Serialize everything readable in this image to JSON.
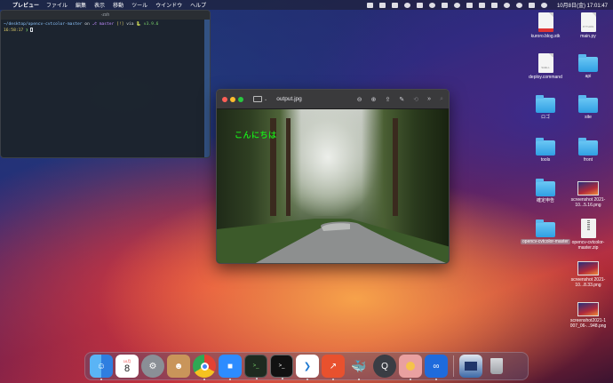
{
  "menubar": {
    "apple_icon": "apple-icon",
    "app_name": "プレビュー",
    "items": [
      "ファイル",
      "編集",
      "表示",
      "移動",
      "ツール",
      "ウインドウ",
      "ヘルプ"
    ],
    "clock": "10月8日(金)  17:01:47"
  },
  "terminal": {
    "title": "-zsh",
    "prompt_path": "~/desktop/opencv-cvtcolor-master",
    "prompt_on": "on",
    "prompt_branch": "master",
    "prompt_status": "[!]",
    "prompt_via": "via",
    "prompt_version": "v3.9.6",
    "prompt_time": "16:58:17",
    "prompt_symbol": "❯"
  },
  "preview": {
    "filename": "output.jpg",
    "image_text": "こんにちは"
  },
  "desktop_icons": [
    {
      "label": "kuroro.blog.stk",
      "kind": "doc",
      "doc_text": ""
    },
    {
      "label": "main.py",
      "kind": "doc",
      "doc_text": "PYTHON"
    },
    {
      "label": "deploy.command",
      "kind": "doc",
      "doc_text": "SHELL"
    },
    {
      "label": "api",
      "kind": "folder"
    },
    {
      "label": "ロゴ",
      "kind": "folder"
    },
    {
      "label": "site",
      "kind": "folder"
    },
    {
      "label": "tools",
      "kind": "folder"
    },
    {
      "label": "front",
      "kind": "folder"
    },
    {
      "label": "確定申告",
      "kind": "folder"
    },
    {
      "label": "screenshot 2021-10...5.16.png",
      "kind": "shot"
    },
    {
      "label": "opencv-cvtcolor-master",
      "kind": "folder"
    },
    {
      "label": "opencv-cvtcolor-master.zip",
      "kind": "zip"
    },
    {
      "label": "screenshot 2021-10...8.33.png",
      "kind": "shot"
    },
    {
      "label": "screenshot2021-1 007_06-...948.png",
      "kind": "shot"
    }
  ],
  "dock": {
    "calendar_month": "10月",
    "calendar_day": "8",
    "apps": [
      "finder",
      "calendar",
      "system-preferences",
      "contacts",
      "chrome",
      "zoom",
      "terminal-1",
      "terminal-2",
      "vscode",
      "sourcetree",
      "docker",
      "quicktime",
      "preview",
      "infinity",
      "screenshot",
      "trash"
    ]
  },
  "colors": {
    "folder": "#2f9fe3",
    "greeting": "#19e019",
    "close": "#ff5f57",
    "minimize": "#febc2e",
    "zoom": "#28c840"
  }
}
